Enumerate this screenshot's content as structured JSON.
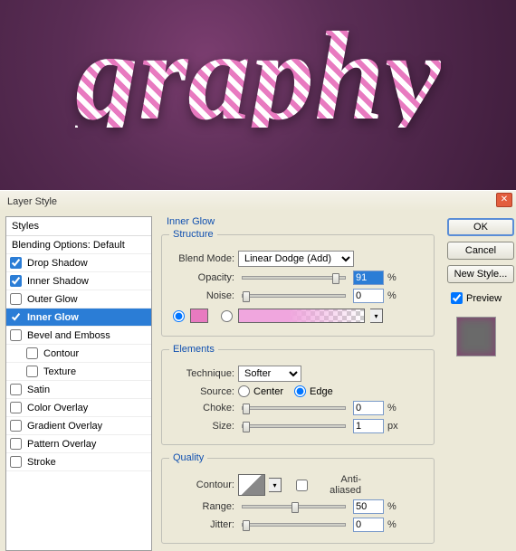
{
  "canvas": {
    "text": "graphy"
  },
  "dialog": {
    "title": "Layer Style",
    "styles_header": "Styles",
    "blending": "Blending Options: Default",
    "items": [
      {
        "label": "Drop Shadow",
        "checked": true
      },
      {
        "label": "Inner Shadow",
        "checked": true
      },
      {
        "label": "Outer Glow",
        "checked": false
      },
      {
        "label": "Inner Glow",
        "checked": true,
        "selected": true
      },
      {
        "label": "Bevel and Emboss",
        "checked": false
      },
      {
        "label": "Contour",
        "checked": false,
        "indent": true
      },
      {
        "label": "Texture",
        "checked": false,
        "indent": true
      },
      {
        "label": "Satin",
        "checked": false
      },
      {
        "label": "Color Overlay",
        "checked": false
      },
      {
        "label": "Gradient Overlay",
        "checked": false
      },
      {
        "label": "Pattern Overlay",
        "checked": false
      },
      {
        "label": "Stroke",
        "checked": false
      }
    ],
    "section_title": "Inner Glow",
    "structure": {
      "legend": "Structure",
      "blend_mode_label": "Blend Mode:",
      "blend_mode_value": "Linear Dodge (Add)",
      "opacity_label": "Opacity:",
      "opacity_value": "91",
      "opacity_unit": "%",
      "noise_label": "Noise:",
      "noise_value": "0",
      "noise_unit": "%",
      "color_hex": "#e87ac0"
    },
    "elements": {
      "legend": "Elements",
      "technique_label": "Technique:",
      "technique_value": "Softer",
      "source_label": "Source:",
      "source_center": "Center",
      "source_edge": "Edge",
      "choke_label": "Choke:",
      "choke_value": "0",
      "choke_unit": "%",
      "size_label": "Size:",
      "size_value": "1",
      "size_unit": "px"
    },
    "quality": {
      "legend": "Quality",
      "contour_label": "Contour:",
      "anti_label": "Anti-aliased",
      "range_label": "Range:",
      "range_value": "50",
      "range_unit": "%",
      "jitter_label": "Jitter:",
      "jitter_value": "0",
      "jitter_unit": "%"
    },
    "buttons": {
      "ok": "OK",
      "cancel": "Cancel",
      "new_style": "New Style...",
      "preview": "Preview"
    }
  }
}
